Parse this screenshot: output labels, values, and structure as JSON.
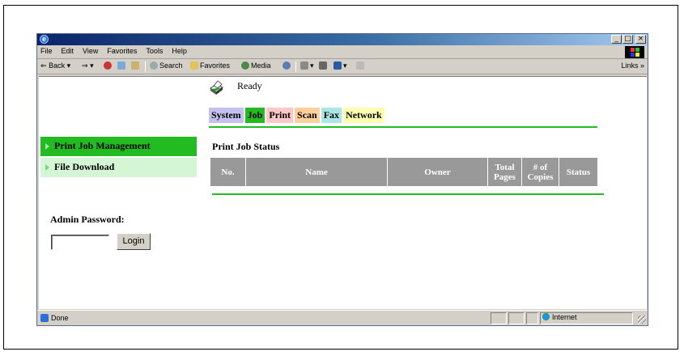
{
  "browser": {
    "menu": [
      "File",
      "Edit",
      "View",
      "Favorites",
      "Tools",
      "Help"
    ],
    "toolbar": {
      "back": "Back",
      "search": "Search",
      "favorites": "Favorites",
      "media": "Media",
      "links": "Links »"
    },
    "window_controls": [
      "_",
      "□",
      "×"
    ],
    "status": {
      "left": "Done",
      "zone": "Internet"
    }
  },
  "device": {
    "status": "Ready"
  },
  "tabs": [
    "System",
    "Job",
    "Print",
    "Scan",
    "Fax",
    "Network"
  ],
  "active_tab": "Job",
  "colors": {
    "active_green": "#22bb22",
    "light_green": "#d4f6d4",
    "table_header_bg": "#999999"
  },
  "sidebar": {
    "items": [
      {
        "label": "Print Job Management",
        "active": true
      },
      {
        "label": "File Download",
        "active": false
      }
    ]
  },
  "main": {
    "section_title": "Print Job Status",
    "table": {
      "columns": [
        "No.",
        "Name",
        "Owner",
        "Total Pages",
        "# of Copies",
        "Status"
      ],
      "rows": []
    }
  },
  "admin": {
    "label": "Admin Password:",
    "login_label": "Login",
    "password_value": ""
  }
}
